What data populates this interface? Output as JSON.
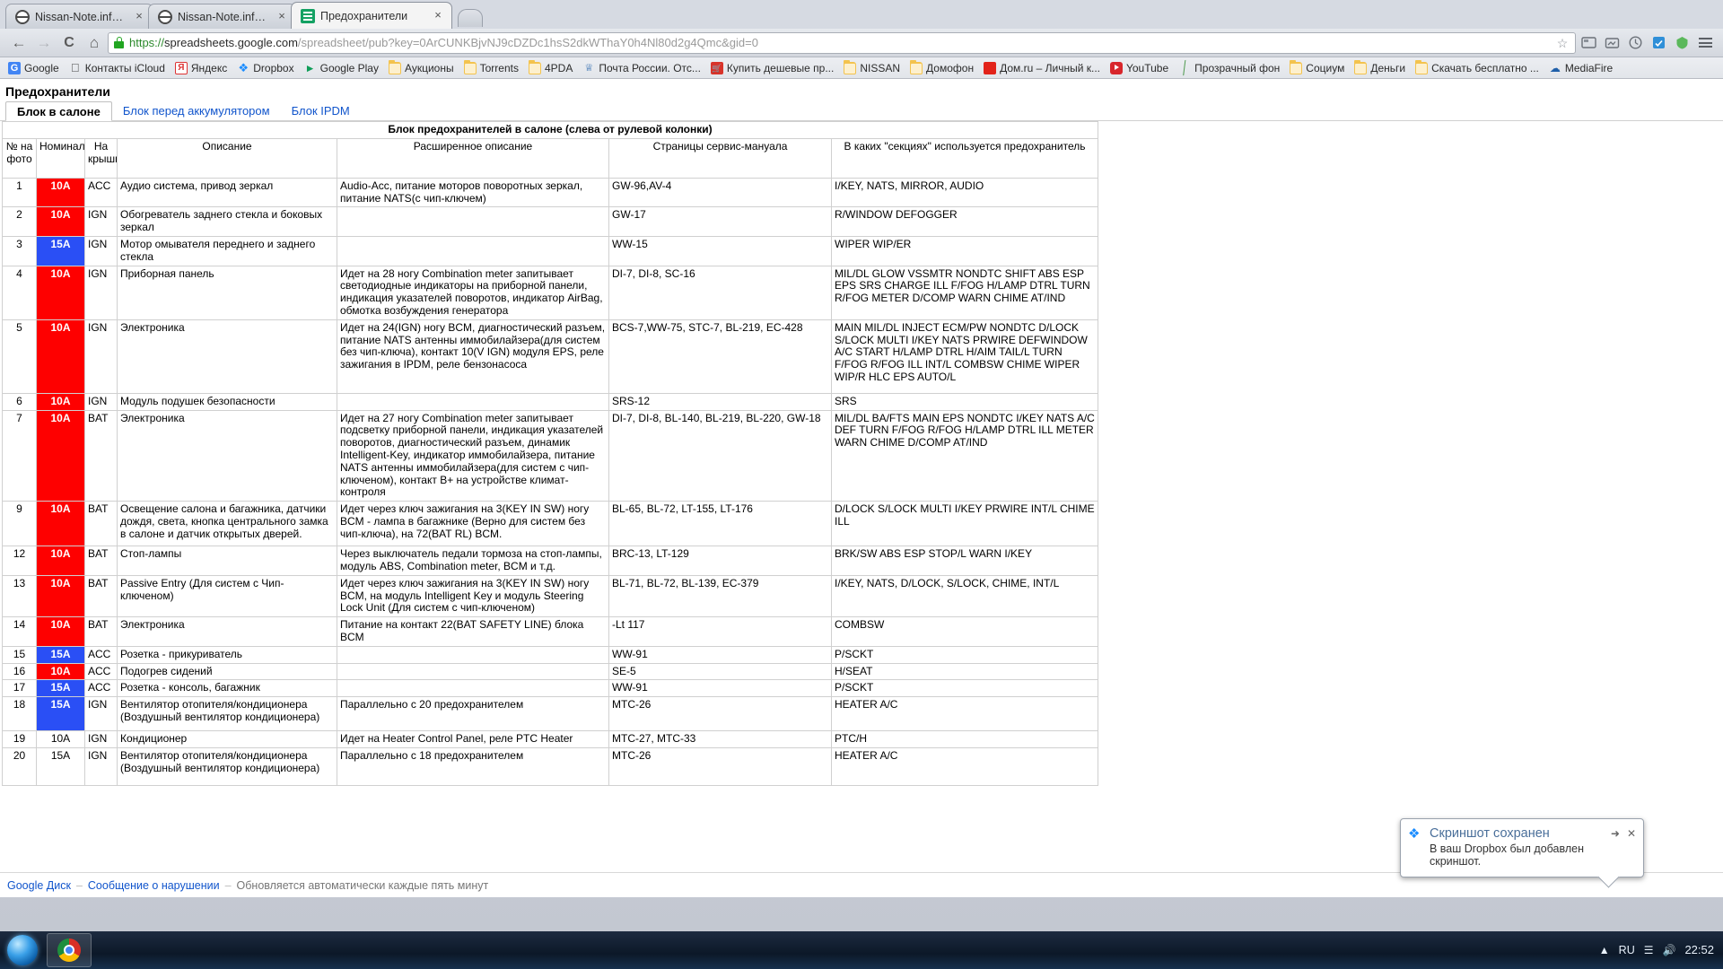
{
  "browser": {
    "tabs": [
      {
        "label": "Nissan-Note.info :: Поиск",
        "icon": "nissan-icon",
        "active": false
      },
      {
        "label": "Nissan-Note.info :: Просм",
        "icon": "nissan-icon",
        "active": false
      },
      {
        "label": "Предохранители",
        "icon": "google-sheets-icon",
        "active": true
      }
    ],
    "nav": {
      "back": "←",
      "forward": "→",
      "reload": "C",
      "home": "⌂"
    },
    "omnibox": {
      "scheme": "https://",
      "host": "spreadsheets.google.com",
      "path": "/spreadsheet/pub?key=0ArCUNKBjvNJ9cDZDc1hsS2dkWThaY0h4Nl80d2g4Qmc&gid=0",
      "lock_icon": "lock-icon",
      "star_icon": "star-icon"
    },
    "bookmarks": [
      {
        "label": "Google",
        "icon": "google-icon"
      },
      {
        "label": "Контакты iCloud",
        "icon": "apple-icon"
      },
      {
        "label": "Яндекс",
        "icon": "yandex-icon"
      },
      {
        "label": "Dropbox",
        "icon": "dropbox-icon"
      },
      {
        "label": "Google Play",
        "icon": "play-icon"
      },
      {
        "label": "Аукционы",
        "icon": "folder-icon"
      },
      {
        "label": "Torrents",
        "icon": "folder-icon"
      },
      {
        "label": "4PDA",
        "icon": "folder-icon"
      },
      {
        "label": "Почта России. Отс...",
        "icon": "post-icon"
      },
      {
        "label": "Купить дешевые пр...",
        "icon": "cart-icon"
      },
      {
        "label": "NISSAN",
        "icon": "folder-icon"
      },
      {
        "label": "Домофон",
        "icon": "folder-icon"
      },
      {
        "label": "Дом.ru – Личный к...",
        "icon": "domru-icon"
      },
      {
        "label": "YouTube",
        "icon": "youtube-icon"
      },
      {
        "label": "Прозрачный фон",
        "icon": "pen-icon"
      },
      {
        "label": "Социум",
        "icon": "folder-icon"
      },
      {
        "label": "Деньги",
        "icon": "folder-icon"
      },
      {
        "label": "Скачать бесплатно ...",
        "icon": "folder-icon"
      },
      {
        "label": "MediaFire",
        "icon": "mediafire-icon"
      }
    ]
  },
  "document": {
    "title": "Предохранители",
    "sheet_tabs": [
      {
        "label": "Блок в салоне",
        "active": true
      },
      {
        "label": "Блок перед аккумулятором",
        "active": false
      },
      {
        "label": "Блок IPDM",
        "active": false
      }
    ],
    "banner": "Блок предохранителей в салоне (слева от рулевой колонки)",
    "headers": [
      "№ на фото",
      "Номинал",
      "На крышке",
      "Описание",
      "Расширенное описание",
      "Страницы сервис-мануала",
      "В каких \"секциях\" используется предохранитель"
    ],
    "rows": [
      {
        "num": "1",
        "rating": "10A",
        "rating_color": "#fe0000",
        "cover": "ACC",
        "desc": "Аудио система, привод зеркал",
        "ext": "Audio-Acc, питание моторов поворотных зеркал, питание NATS(с чип-ключем)",
        "pages": "GW-96,AV-4",
        "sections": "I/KEY, NATS, MIRROR, AUDIO"
      },
      {
        "num": "2",
        "rating": "10A",
        "rating_color": "#fe0000",
        "cover": "IGN",
        "desc": "Обогреватель заднего стекла и боковых зеркал",
        "ext": "",
        "pages": "GW-17",
        "sections": "R/WINDOW DEFOGGER"
      },
      {
        "num": "3",
        "rating": "15A",
        "rating_color": "#2a4ff5",
        "cover": "IGN",
        "desc": "Мотор омывателя переднего и заднего стекла",
        "ext": "",
        "pages": "WW-15",
        "sections": "WIPER WIP/ER"
      },
      {
        "num": "4",
        "rating": "10A",
        "rating_color": "#fe0000",
        "cover": "IGN",
        "desc": "Приборная панель",
        "ext": "Идет на 28 ногу Combination meter запитывает светодиодные индикаторы на приборной панели, индикация указателей поворотов, индикатор AirBag, обмотка возбуждения генератора",
        "pages": "DI-7, DI-8, SC-16",
        "sections": "MIL/DL GLOW VSSMTR NONDTC SHIFT ABS ESP EPS SRS CHARGE ILL F/FOG H/LAMP DTRL TURN R/FOG METER D/COMP WARN CHIME AT/IND"
      },
      {
        "num": "5",
        "rating": "10A",
        "rating_color": "#fe0000",
        "cover": "IGN",
        "desc": "Электроника",
        "ext": "Идет на 24(IGN) ногу BCM, диагностический разъем, питание NATS антенны иммобилайзера(для систем без чип-ключа), контакт 10(V IGN) модуля EPS, реле зажигания в IPDM, реле бензонасоса",
        "pages": "BCS-7,WW-75, STC-7, BL-219, EC-428",
        "sections": "MAIN MIL/DL INJECT ECM/PW NONDTC D/LOCK S/LOCK MULTI I/KEY NATS PRWIRE DEFWINDOW A/C START H/LAMP DTRL H/AIM TAIL/L TURN F/FOG R/FOG ILL INT/L COMBSW CHIME WIPER WIP/R HLC EPS AUTO/L"
      },
      {
        "num": "6",
        "rating": "10A",
        "rating_color": "#fe0000",
        "cover": "IGN",
        "desc": "Модуль подушек безопасности",
        "ext": "",
        "pages": "SRS-12",
        "sections": "SRS"
      },
      {
        "num": "7",
        "rating": "10A",
        "rating_color": "#fe0000",
        "cover": "BAT",
        "desc": "Электроника",
        "ext": "Идет на 27 ногу Combination meter запитывает подсветку приборной панели, индикация указателей поворотов, диагностический разъем, динамик Intelligent-Key, индикатор иммобилайзера, питание NATS антенны иммобилайзера(для систем с чип-ключеном), контакт B+ на устройстве климат-контроля",
        "pages": "DI-7, DI-8, BL-140, BL-219, BL-220, GW-18",
        "sections": "MIL/DL BA/FTS MAIN EPS NONDTC I/KEY NATS A/C DEF TURN F/FOG R/FOG H/LAMP DTRL ILL METER WARN CHIME D/COMP AT/IND"
      },
      {
        "num": "9",
        "rating": "10A",
        "rating_color": "#fe0000",
        "cover": "BAT",
        "desc": "Освещение салона и багажника, датчики дождя, света, кнопка центрального замка в салоне и датчик открытых дверей.",
        "ext": "Идет через ключ зажигания на 3(KEY IN SW) ногу BCM - лампа в багажнике (Верно для систем без чип-ключа), на 72(BAT RL) BCM.",
        "pages": "BL-65, BL-72, LT-155, LT-176",
        "sections": "D/LOCK S/LOCK MULTI I/KEY PRWIRE INT/L CHIME ILL"
      },
      {
        "num": "12",
        "rating": "10A",
        "rating_color": "#fe0000",
        "cover": "BAT",
        "desc": "Стоп-лампы",
        "ext": "Через выключатель педали тормоза на стоп-лампы, модуль ABS, Combination meter, BCM и т.д.",
        "pages": "BRC-13, LT-129",
        "sections": "BRK/SW ABS ESP STOP/L WARN I/KEY"
      },
      {
        "num": "13",
        "rating": "10A",
        "rating_color": "#fe0000",
        "cover": "BAT",
        "desc": "Passive Entry (Для систем с Чип-ключеном)",
        "ext": "Идет через ключ зажигания на 3(KEY IN SW) ногу BCM, на модуль Intelligent Key и модуль Steering Lock Unit (Для систем с чип-ключеном)",
        "pages": "BL-71, BL-72, BL-139, EC-379",
        "sections": "I/KEY, NATS, D/LOCK, S/LOCK, CHIME, INT/L"
      },
      {
        "num": "14",
        "rating": "10A",
        "rating_color": "#fe0000",
        "cover": "BAT",
        "desc": "Электроника",
        "ext": "Питание на контакт 22(BAT SAFETY LINE) блока BCM",
        "pages": "-Lt 117",
        "sections": "COMBSW"
      },
      {
        "num": "15",
        "rating": "15A",
        "rating_color": "#2a4ff5",
        "cover": "ACC",
        "desc": "Розетка - прикуриватель",
        "ext": "",
        "pages": "WW-91",
        "sections": "P/SCKT"
      },
      {
        "num": "16",
        "rating": "10A",
        "rating_color": "#fe0000",
        "cover": "ACC",
        "desc": "Подогрев сидений",
        "ext": "",
        "pages": "SE-5",
        "sections": "H/SEAT"
      },
      {
        "num": "17",
        "rating": "15A",
        "rating_color": "#2a4ff5",
        "cover": "ACC",
        "desc": "Розетка - консоль, багажник",
        "ext": "",
        "pages": "WW-91",
        "sections": "P/SCKT"
      },
      {
        "num": "18",
        "rating": "15A",
        "rating_color": "#2a4ff5",
        "cover": "IGN",
        "desc": "Вентилятор отопителя/кондиционера (Воздушный вентилятор кондиционера)",
        "ext": "Параллельно с 20 предохранителем",
        "pages": "MTC-26",
        "sections": "HEATER A/C"
      },
      {
        "num": "19",
        "rating": "10A",
        "rating_color": "transparent",
        "cover": "IGN",
        "desc": "Кондиционер",
        "ext": "Идет на Heater Control Panel, реле PTC Heater",
        "pages": "MTC-27, MTC-33",
        "sections": "PTC/H"
      },
      {
        "num": "20",
        "rating": "15A",
        "rating_color": "transparent",
        "cover": "IGN",
        "desc": "Вентилятор отопителя/кондиционера (Воздушный вентилятор кондиционера)",
        "ext": "Параллельно с 18 предохранителем",
        "pages": "MTC-26",
        "sections": "HEATER A/C"
      }
    ],
    "footer": {
      "drive_link": "Google Диск",
      "report_link": "Сообщение о нарушении",
      "sep1": "–",
      "sep2": "–",
      "status": "Обновляется автоматически каждые пять минут"
    }
  },
  "toast": {
    "icon": "dropbox-icon",
    "title": "Скриншот сохранен",
    "body": "В ваш Dropbox был добавлен скриншот.",
    "minimize_icon": "collapse-icon",
    "close_icon": "close-icon"
  },
  "taskbar": {
    "start_icon": "windows-start-orb",
    "items": [
      {
        "icon": "chrome-icon",
        "label": "Google Chrome"
      }
    ],
    "tray": {
      "lang": "RU",
      "clock": "22:52",
      "network_icon": "network-icon",
      "volume_icon": "volume-icon",
      "arrow_icon": "show-hidden-icons"
    }
  }
}
